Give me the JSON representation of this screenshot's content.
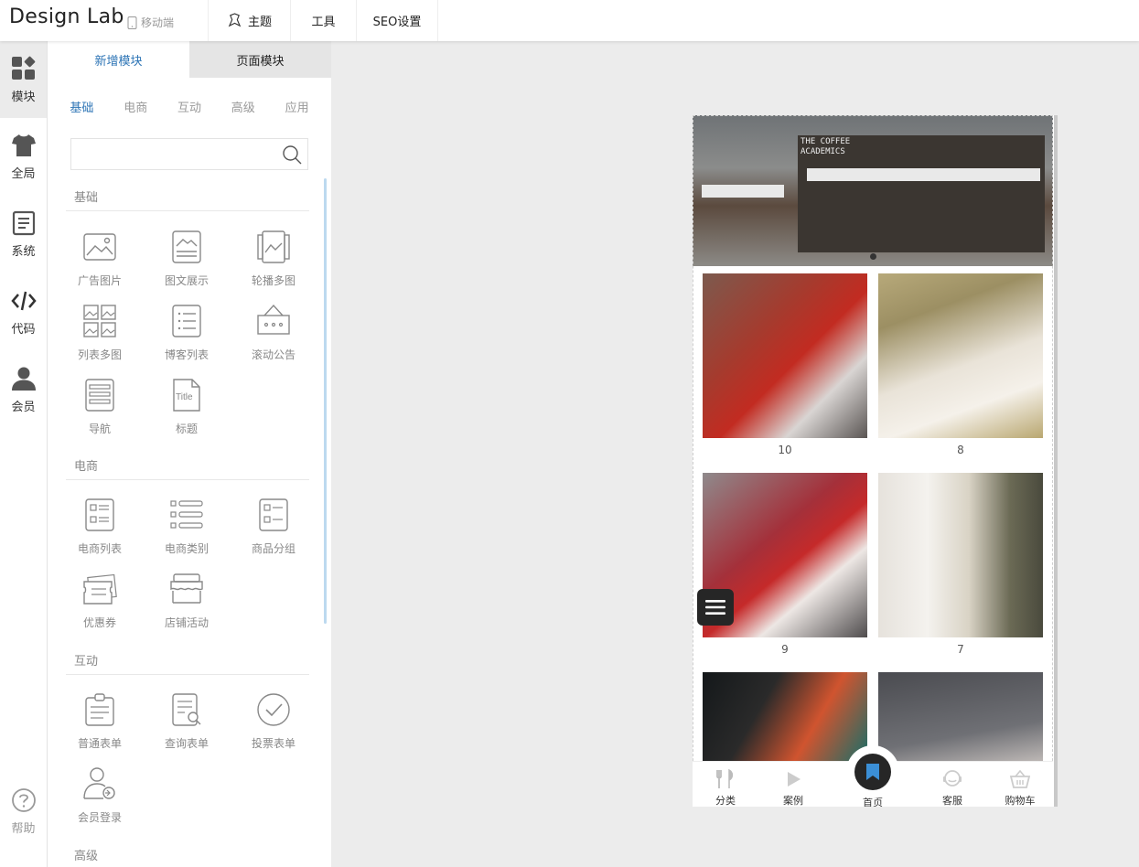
{
  "app": {
    "title": "Design Lab",
    "mobile_label": "移动端"
  },
  "topnav": [
    {
      "label": "主题",
      "icon": "theme-icon"
    },
    {
      "label": "工具"
    },
    {
      "label": "SEO设置"
    }
  ],
  "rail": [
    {
      "label": "模块",
      "icon": "modules-icon",
      "active": true
    },
    {
      "label": "全局",
      "icon": "shirt-icon"
    },
    {
      "label": "系统",
      "icon": "system-icon"
    },
    {
      "label": "代码",
      "icon": "code-icon"
    },
    {
      "label": "会员",
      "icon": "member-icon"
    },
    {
      "label": "帮助",
      "icon": "help-icon"
    }
  ],
  "panel": {
    "tabs": [
      "新增模块",
      "页面模块"
    ],
    "categories": [
      "基础",
      "电商",
      "互动",
      "高级",
      "应用"
    ],
    "search_placeholder": "",
    "sections": [
      {
        "title": "基础",
        "items": [
          "广告图片",
          "图文展示",
          "轮播多图",
          "列表多图",
          "博客列表",
          "滚动公告",
          "导航",
          "标题"
        ]
      },
      {
        "title": "电商",
        "items": [
          "电商列表",
          "电商类别",
          "商品分组",
          "优惠券",
          "店铺活动"
        ]
      },
      {
        "title": "互动",
        "items": [
          "普通表单",
          "查询表单",
          "投票表单",
          "会员登录"
        ]
      },
      {
        "title": "高级",
        "items": []
      }
    ]
  },
  "preview": {
    "banner_sign": "THE COFFEE ACADEMICS",
    "tiles": [
      {
        "caption": "10"
      },
      {
        "caption": "8"
      },
      {
        "caption": "9"
      },
      {
        "caption": "7"
      },
      {
        "caption": ""
      },
      {
        "caption": ""
      }
    ],
    "tabbar": [
      {
        "label": "分类",
        "icon": "category-icon"
      },
      {
        "label": "案例",
        "icon": "play-icon"
      },
      {
        "label": "首页",
        "icon": "bookmark-icon"
      },
      {
        "label": "客服",
        "icon": "service-icon"
      },
      {
        "label": "购物车",
        "icon": "cart-icon"
      }
    ]
  },
  "colors": {
    "accent": "#2e75b6",
    "dark": "#262626"
  }
}
